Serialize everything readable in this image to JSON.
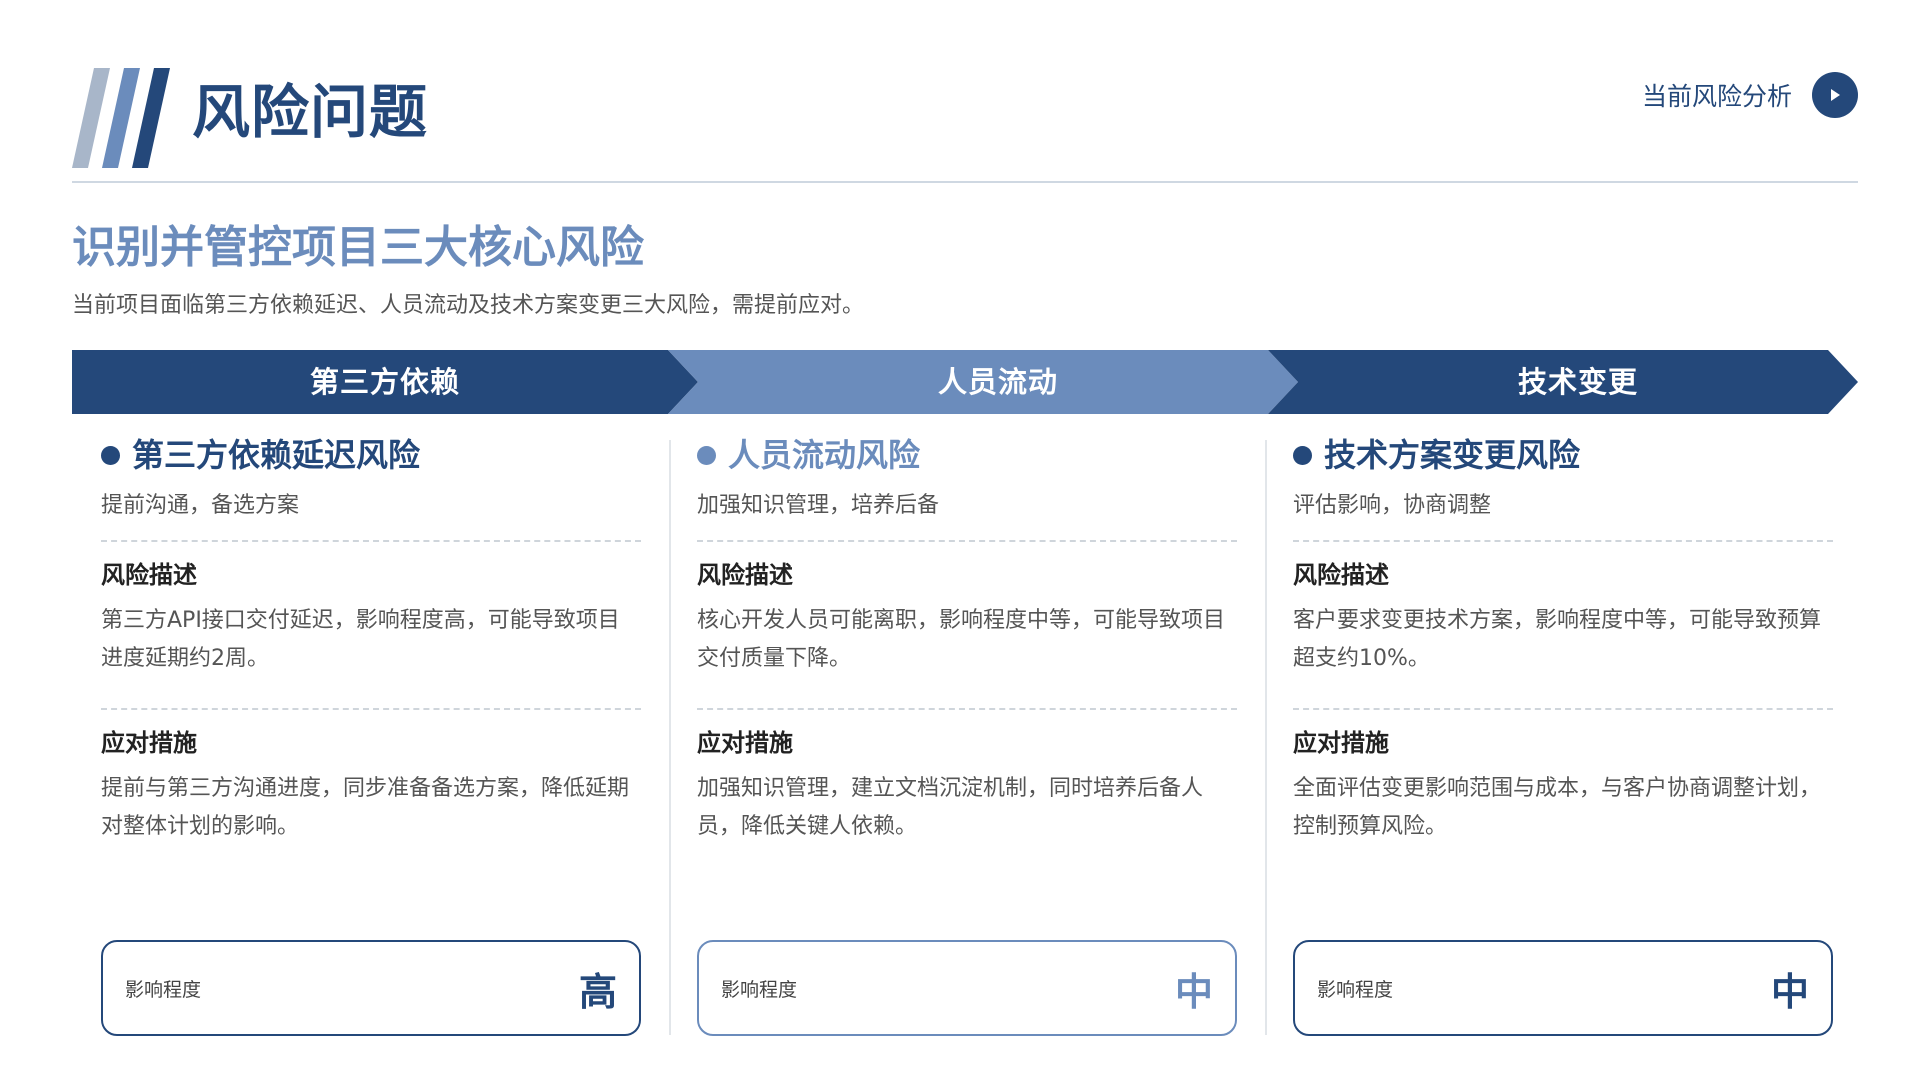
{
  "header": {
    "title": "风险问题",
    "section_link": "当前风险分析"
  },
  "headline": {
    "subtitle": "识别并管控项目三大核心风险",
    "intro": "当前项目面临第三方依赖延迟、人员流动及技术方案变更三大风险，需提前应对。"
  },
  "colors": {
    "primary": "#24487a",
    "secondary": "#6b8cbc"
  },
  "banner": {
    "segments": [
      {
        "label": "第三方依赖"
      },
      {
        "label": "人员流动"
      },
      {
        "label": "技术变更"
      }
    ]
  },
  "risks": [
    {
      "title": "第三方依赖延迟风险",
      "tagline": "提前沟通，备选方案",
      "desc_label": "风险描述",
      "desc": "第三方API接口交付延迟，影响程度高，可能导致项目进度延期约2周。",
      "measure_label": "应对措施",
      "measure": "提前与第三方沟通进度，同步准备备选方案，降低延期对整体计划的影响。",
      "impact_label": "影响程度",
      "impact_level": "高"
    },
    {
      "title": "人员流动风险",
      "tagline": "加强知识管理，培养后备",
      "desc_label": "风险描述",
      "desc": "核心开发人员可能离职，影响程度中等，可能导致项目交付质量下降。",
      "measure_label": "应对措施",
      "measure": "加强知识管理，建立文档沉淀机制，同时培养后备人员，降低关键人依赖。",
      "impact_label": "影响程度",
      "impact_level": "中"
    },
    {
      "title": "技术方案变更风险",
      "tagline": "评估影响，协商调整",
      "desc_label": "风险描述",
      "desc": "客户要求变更技术方案，影响程度中等，可能导致预算超支约10%。",
      "measure_label": "应对措施",
      "measure": "全面评估变更影响范围与成本，与客户协商调整计划，控制预算风险。",
      "impact_label": "影响程度",
      "impact_level": "中"
    }
  ]
}
